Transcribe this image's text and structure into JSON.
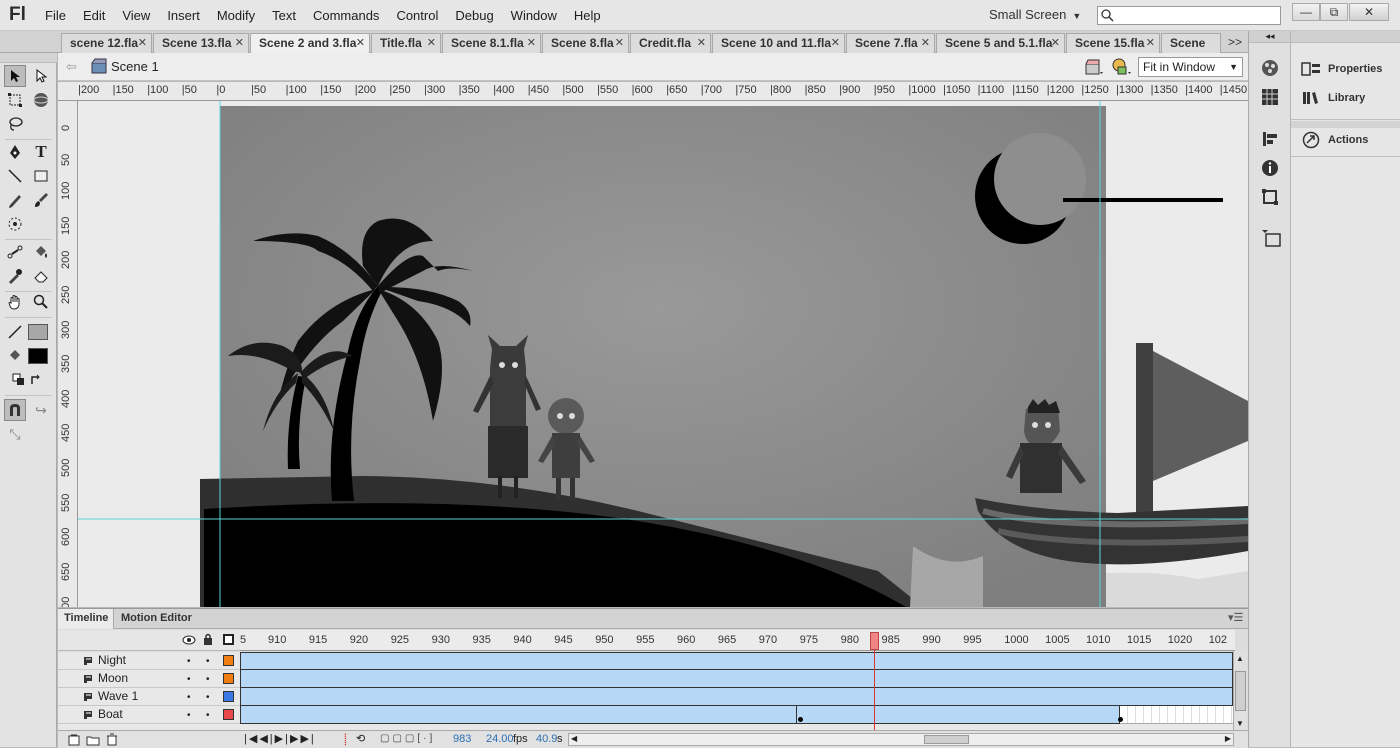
{
  "app": {
    "logo": "Fl",
    "workspace": "Small Screen"
  },
  "menu": [
    "File",
    "Edit",
    "View",
    "Insert",
    "Modify",
    "Text",
    "Commands",
    "Control",
    "Debug",
    "Window",
    "Help"
  ],
  "window_buttons": [
    "—",
    "⧉",
    "✕"
  ],
  "tabs": [
    "scene 12.fla",
    "Scene 13.fla",
    "Scene 2 and 3.fla",
    "Title.fla",
    "Scene 8.1.fla",
    "Scene 8.fla",
    "Credit.fla",
    "Scene 10 and 11.fla",
    "Scene 7.fla",
    "Scene 5 and 5.1.fla",
    "Scene 15.fla",
    "Scene"
  ],
  "active_tab": "Scene 2 and 3.fla",
  "tab_overflow": ">>",
  "editbar": {
    "scene": "Scene 1",
    "zoom": "Fit in Window"
  },
  "ruler_h": [
    "200",
    "150",
    "100",
    "50",
    "0",
    "50",
    "100",
    "150",
    "200",
    "250",
    "300",
    "350",
    "400",
    "450",
    "500",
    "550",
    "600",
    "650",
    "700",
    "750",
    "800",
    "850",
    "900",
    "950",
    "1000",
    "1050",
    "1100",
    "1150",
    "1200",
    "1250",
    "1300",
    "1350",
    "1400",
    "1450"
  ],
  "ruler_v": [
    "0",
    "50",
    "100",
    "150",
    "200",
    "250",
    "300",
    "350",
    "400",
    "450",
    "500",
    "550",
    "600",
    "650",
    "700"
  ],
  "right_panel": {
    "items": [
      "Properties",
      "Library",
      "Actions"
    ]
  },
  "timeline": {
    "tabs": [
      "Timeline",
      "Motion Editor"
    ],
    "frame_numbers": [
      "5",
      "910",
      "915",
      "920",
      "925",
      "930",
      "935",
      "940",
      "945",
      "950",
      "955",
      "960",
      "965",
      "970",
      "975",
      "980",
      "985",
      "990",
      "995",
      "1000",
      "1005",
      "1010",
      "1015",
      "1020",
      "102"
    ],
    "layers": [
      {
        "name": "Night",
        "color": "#f07d12"
      },
      {
        "name": "Moon",
        "color": "#f07d12"
      },
      {
        "name": "Wave 1",
        "color": "#3a78e6"
      },
      {
        "name": "Boat",
        "color": "#e8474b"
      }
    ],
    "current_frame": "983",
    "fps": "24.00",
    "fps_unit": "fps",
    "time": "40.9",
    "time_unit": "s"
  }
}
